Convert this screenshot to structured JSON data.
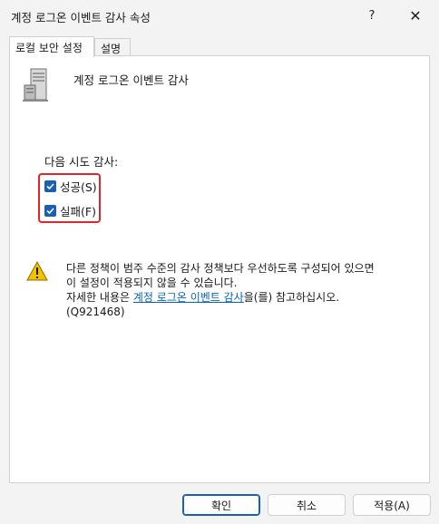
{
  "window": {
    "title": "계정 로그온 이벤트 감사 속성",
    "help_glyph": "?",
    "close_glyph": "✕"
  },
  "tabs": [
    {
      "label": "로컬 보안 설정",
      "active": true
    },
    {
      "label": "설명",
      "active": false
    }
  ],
  "policy": {
    "icon": "server-icon",
    "name": "계정 로그온 이벤트 감사"
  },
  "audit": {
    "label": "다음 시도 감사:",
    "options": [
      {
        "label": "성공(S)",
        "checked": true
      },
      {
        "label": "실패(F)",
        "checked": true
      }
    ]
  },
  "warning": {
    "icon": "warning-icon",
    "line1": "다른 정책이 범주 수준의 감사 정책보다 우선하도록 구성되어 있으면",
    "line2": "이 설정이 적용되지 않을 수 있습니다.",
    "line3_prefix": "자세한 내용은 ",
    "line3_link": "계정 로그온 이벤트 감사",
    "line3_suffix": "을(를) 참고하십시오.",
    "line4": "(Q921468)"
  },
  "buttons": {
    "ok": "확인",
    "cancel": "취소",
    "apply": "적용(A)"
  },
  "colors": {
    "accent": "#1a5fb4",
    "highlight": "#e0262a",
    "link": "#0a63b6",
    "warning": "#f2c200"
  }
}
